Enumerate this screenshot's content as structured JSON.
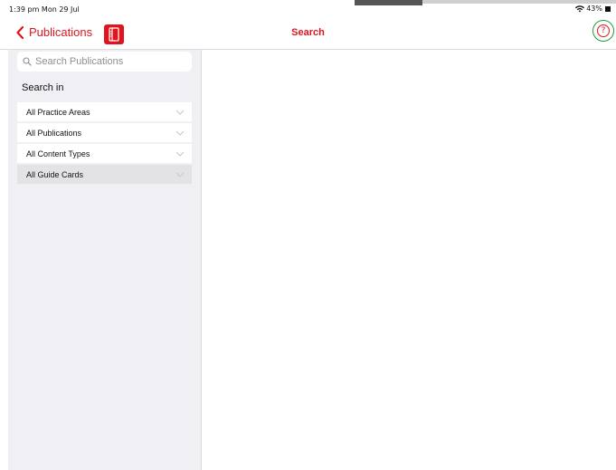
{
  "status_bar": {
    "time": "1:39 pm  Mon 29 Jul",
    "battery": "43%"
  },
  "nav": {
    "back_label": "Publications",
    "title": "Search",
    "help_glyph": "?"
  },
  "sidebar": {
    "search_placeholder": "Search Publications",
    "section_header": "Search in",
    "filters": [
      {
        "label": "All Practice Areas"
      },
      {
        "label": "All Publications"
      },
      {
        "label": "All Content Types"
      },
      {
        "label": "All Guide Cards"
      }
    ]
  },
  "icons": {
    "back": "chevron-left-icon",
    "book": "book-icon",
    "help": "question-circle-icon",
    "search": "search-icon",
    "dropdown": "chevron-down-icon",
    "wifi": "wifi-icon",
    "battery": "battery-icon"
  },
  "colors": {
    "accent": "#e0141e",
    "sidebar_bg": "#efeff4",
    "selected_row": "#e3e3e6",
    "help_highlight": "#1f9e3a"
  }
}
